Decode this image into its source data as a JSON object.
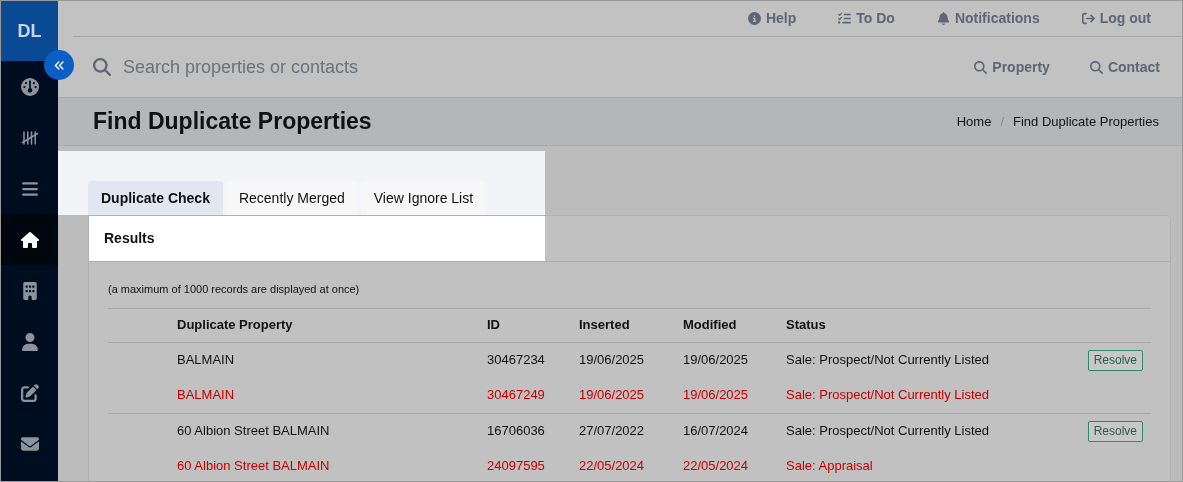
{
  "brand": {
    "initials": "DL"
  },
  "sidebar": {
    "items": [
      {
        "selected": false
      },
      {
        "selected": false
      },
      {
        "selected": false
      },
      {
        "selected": true
      },
      {
        "selected": false
      },
      {
        "selected": false
      },
      {
        "selected": false
      },
      {
        "selected": false
      }
    ]
  },
  "top_links": [
    {
      "label": "Help"
    },
    {
      "label": "To Do"
    },
    {
      "label": "Notifications"
    },
    {
      "label": "Log out"
    }
  ],
  "search": {
    "placeholder": "Search properties or contacts",
    "buttons": [
      "Property",
      "Contact"
    ]
  },
  "page": {
    "title": "Find Duplicate Properties",
    "breadcrumb": [
      "Home",
      "Find Duplicate Properties"
    ],
    "breadcrumb_separator": "/"
  },
  "tabs": [
    {
      "label": "Duplicate Check",
      "selected": true
    },
    {
      "label": "Recently Merged",
      "selected": false
    },
    {
      "label": "View Ignore List",
      "selected": false
    }
  ],
  "card": {
    "title": "Results",
    "note": "(a maximum of 1000 records are displayed at once)"
  },
  "table": {
    "columns": [
      "Duplicate Property",
      "ID",
      "Inserted",
      "Modified",
      "Status"
    ],
    "groups": [
      {
        "rows": [
          {
            "kind": "primary",
            "cells": [
              "BALMAIN",
              "30467234",
              "19/06/2025",
              "19/06/2025",
              "Sale: Prospect/Not Currently Listed"
            ],
            "action": "Resolve"
          },
          {
            "kind": "duplicate",
            "cells": [
              "BALMAIN",
              "30467249",
              "19/06/2025",
              "19/06/2025",
              "Sale: Prospect/Not Currently Listed"
            ]
          }
        ]
      },
      {
        "rows": [
          {
            "kind": "primary",
            "cells": [
              "60 Albion Street BALMAIN",
              "16706036",
              "27/07/2022",
              "16/07/2024",
              "Sale: Prospect/Not Currently Listed"
            ],
            "action": "Resolve"
          },
          {
            "kind": "duplicate",
            "cells": [
              "60 Albion Street BALMAIN",
              "24097595",
              "22/05/2024",
              "22/05/2024",
              "Sale: Appraisal"
            ]
          }
        ]
      }
    ]
  }
}
